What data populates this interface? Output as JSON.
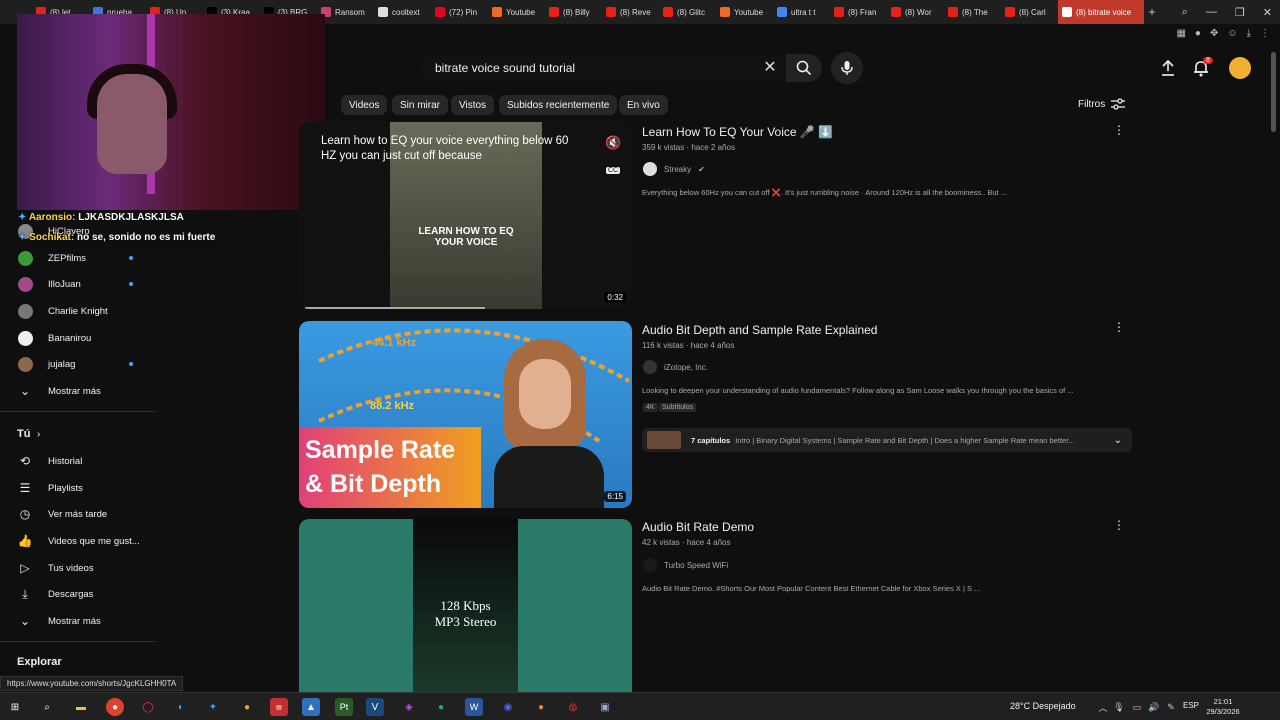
{
  "browser": {
    "tabs": [
      {
        "label": "(8) let",
        "fav_color": "#e62117"
      },
      {
        "label": "prueba",
        "fav_color": "#3a7bd5"
      },
      {
        "label": "(8) Un",
        "fav_color": "#e62117"
      },
      {
        "label": "(3) Kraa",
        "fav_color": "#000000"
      },
      {
        "label": "(3) BRG",
        "fav_color": "#000000"
      },
      {
        "label": "Ransom",
        "fav_color": "#d23b6a"
      },
      {
        "label": "cooltext",
        "fav_color": "#dddddd"
      },
      {
        "label": "(72) Pin",
        "fav_color": "#e60023"
      },
      {
        "label": "Youtube",
        "fav_color": "#f26a21"
      },
      {
        "label": "(8) Billy",
        "fav_color": "#e62117"
      },
      {
        "label": "(8) Reve",
        "fav_color": "#e62117"
      },
      {
        "label": "(8) Glitc",
        "fav_color": "#e62117"
      },
      {
        "label": "Youtube",
        "fav_color": "#f26a21"
      },
      {
        "label": "ultra t t",
        "fav_color": "#4285f4"
      },
      {
        "label": "(8) Fran",
        "fav_color": "#e62117"
      },
      {
        "label": "(8) Wor",
        "fav_color": "#e62117"
      },
      {
        "label": "(8) The",
        "fav_color": "#e62117"
      },
      {
        "label": "(8) Carl",
        "fav_color": "#e62117"
      },
      {
        "label": "(8) bitrate voice",
        "fav_color": "#ffffff",
        "active": true
      }
    ],
    "new_tab": "+",
    "status_url": "https://www.youtube.com/shorts/JgcKLGHH0TA"
  },
  "youtube": {
    "search_query": "bitrate voice sound tutorial",
    "notification_count": "8",
    "chips": [
      {
        "label": "Videos"
      },
      {
        "label": "Sin mirar"
      },
      {
        "label": "Vistos"
      },
      {
        "label": "Subidos recientemente"
      },
      {
        "label": "En vivo"
      }
    ],
    "filters_label": "Filtros",
    "sidebar": {
      "subscriptions": [
        {
          "label": "HiClavero",
          "color": "#888888",
          "dot": false
        },
        {
          "label": "ZEPfilms",
          "color": "#3a9a3a",
          "dot": true
        },
        {
          "label": "IlloJuan",
          "color": "#a04a8a",
          "dot": true
        },
        {
          "label": "Charlie Knight",
          "color": "#777777",
          "dot": false
        },
        {
          "label": "Bananirou",
          "color": "#eeeeee",
          "dot": false
        },
        {
          "label": "jujalag",
          "color": "#8a6a4a",
          "dot": true
        }
      ],
      "show_more_1": "Mostrar más",
      "you_label": "Tú",
      "you_items": [
        {
          "label": "Historial",
          "icon": "history-icon"
        },
        {
          "label": "Playlists",
          "icon": "playlists-icon"
        },
        {
          "label": "Ver más tarde",
          "icon": "clock-icon"
        },
        {
          "label": "Videos que me gust...",
          "icon": "thumbs-up-icon"
        },
        {
          "label": "Tus videos",
          "icon": "video-icon"
        },
        {
          "label": "Descargas",
          "icon": "download-icon"
        }
      ],
      "show_more_2": "Mostrar más",
      "explore_label": "Explorar"
    },
    "chat": [
      {
        "name": "Aaronsio:",
        "text": "LJKASDKJLASKJLSA"
      },
      {
        "name": "Sochikat:",
        "text": "no se, sonido no es mi fuerte"
      }
    ],
    "videos": [
      {
        "title": "Learn How To EQ Your Voice 🎤 ⬇️",
        "meta": "359 k vistas · hace 2 años",
        "channel": "Streaky",
        "verified": true,
        "desc": "Everything below 60Hz you can cut off ❌. It's just rumbling noise · Around 120Hz is all the boominess.. But ...",
        "duration": "0:32",
        "caption_top": "Learn how to EQ your voice everything below 60 HZ you can just cut off because",
        "caption_center": "LEARN HOW TO EQ YOUR VOICE",
        "cc": "CC"
      },
      {
        "title": "Audio Bit Depth and Sample Rate Explained",
        "meta": "116 k vistas · hace 4 años",
        "channel": "iZotope, Inc.",
        "verified": false,
        "desc": "Looking to deepen your understanding of audio fundamentals? Follow along as Sam Loose walks you through you the basics of ...",
        "badges": [
          "4K",
          "Subtítulos"
        ],
        "duration": "6:15",
        "thumb_big": "Sample Rate & Bit Depth",
        "thumb_khz1": "44.1 kHz",
        "thumb_khz2": "88.2 kHz",
        "chapters_count": "7 capítulos",
        "chapters_text": "Intro | Binary Digital Systems | Sample Rate and Bit Depth | Does a higher Sample Rate mean better..."
      },
      {
        "title": "Audio Bit Rate Demo",
        "meta": "42 k vistas · hace 4 años",
        "channel": "Turbo Speed WiFi",
        "verified": false,
        "desc": "Audio Bit Rate Demo. #Shorts Our Most Popular Content Best Ethernet Cable for Xbox Series X | S ...",
        "thumb_text1": "128 Kbps",
        "thumb_text2": "MP3 Stereo"
      }
    ]
  },
  "taskbar": {
    "weather": "28°C  Despejado",
    "lang": "ESP",
    "time": "21:01",
    "date": "29/3/2026"
  },
  "colors": {
    "bg": "#0f0f0f",
    "active_tab": "#c0392b",
    "yt_red": "#e62117",
    "accent_blue": "#3ea6ff"
  }
}
